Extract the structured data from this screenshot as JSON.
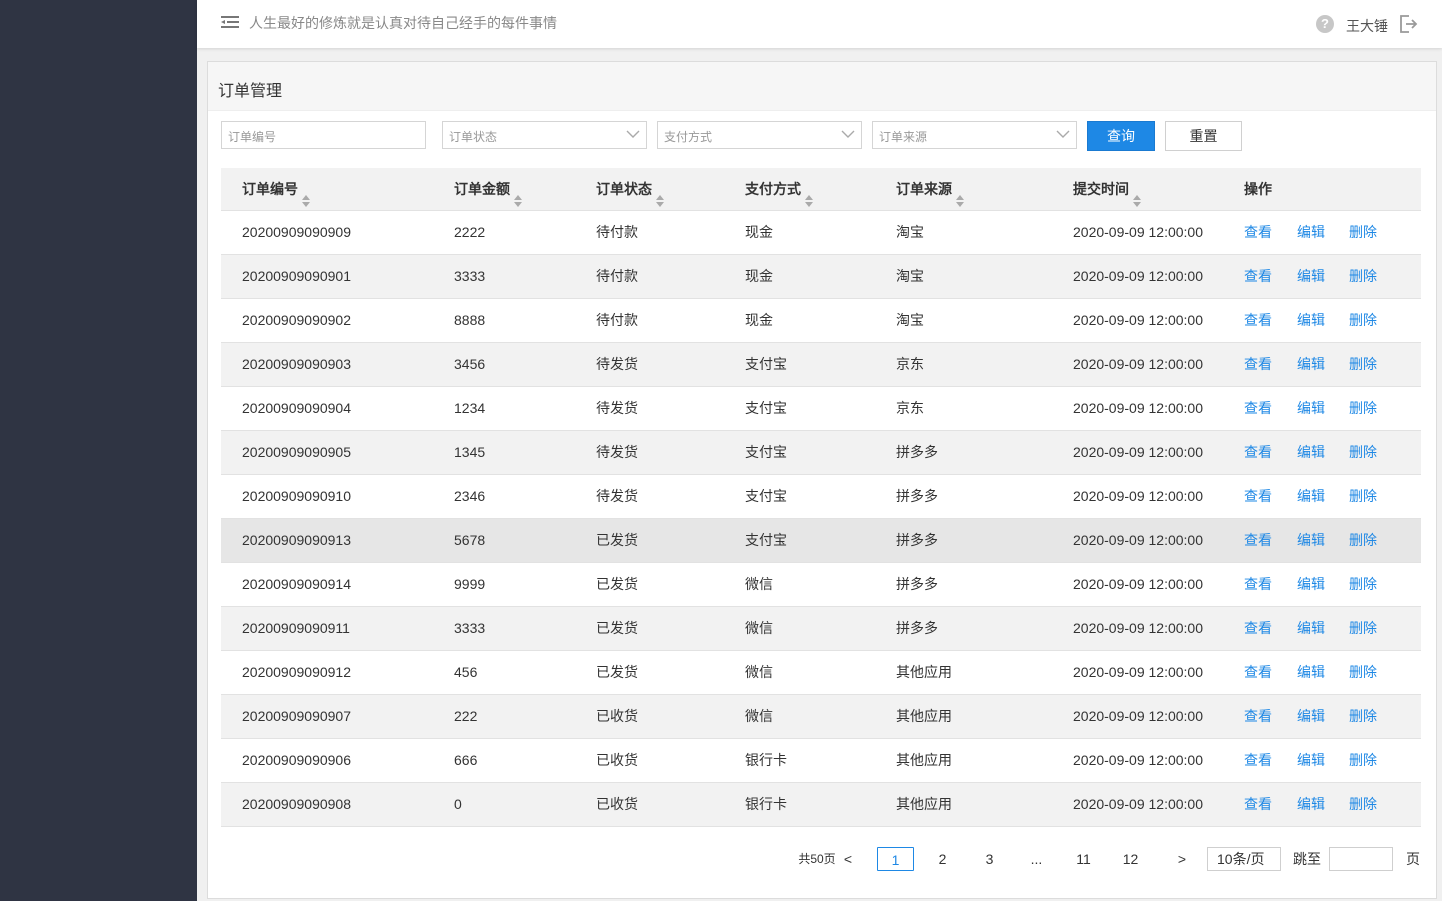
{
  "header": {
    "motto": "人生最好的修炼就是认真对待自己经手的每件事情",
    "username": "王大锤",
    "help_icon": "?"
  },
  "panel": {
    "title": "订单管理"
  },
  "filters": {
    "order_no_placeholder": "订单编号",
    "status_placeholder": "订单状态",
    "payment_placeholder": "支付方式",
    "source_placeholder": "订单来源",
    "query_label": "查询",
    "reset_label": "重置"
  },
  "table": {
    "columns": [
      "订单编号",
      "订单金额",
      "订单状态",
      "支付方式",
      "订单来源",
      "提交时间",
      "操作"
    ],
    "rows": [
      [
        "20200909090909",
        "2222",
        "待付款",
        "现金",
        "淘宝",
        "2020-09-09 12:00:00"
      ],
      [
        "20200909090901",
        "3333",
        "待付款",
        "现金",
        "淘宝",
        "2020-09-09 12:00:00"
      ],
      [
        "20200909090902",
        "8888",
        "待付款",
        "现金",
        "淘宝",
        "2020-09-09 12:00:00"
      ],
      [
        "20200909090903",
        "3456",
        "待发货",
        "支付宝",
        "京东",
        "2020-09-09 12:00:00"
      ],
      [
        "20200909090904",
        "1234",
        "待发货",
        "支付宝",
        "京东",
        "2020-09-09 12:00:00"
      ],
      [
        "20200909090905",
        "1345",
        "待发货",
        "支付宝",
        "拼多多",
        "2020-09-09 12:00:00"
      ],
      [
        "20200909090910",
        "2346",
        "待发货",
        "支付宝",
        "拼多多",
        "2020-09-09 12:00:00"
      ],
      [
        "20200909090913",
        "5678",
        "已发货",
        "支付宝",
        "拼多多",
        "2020-09-09 12:00:00"
      ],
      [
        "20200909090914",
        "9999",
        "已发货",
        "微信",
        "拼多多",
        "2020-09-09 12:00:00"
      ],
      [
        "20200909090911",
        "3333",
        "已发货",
        "微信",
        "拼多多",
        "2020-09-09 12:00:00"
      ],
      [
        "20200909090912",
        "456",
        "已发货",
        "微信",
        "其他应用",
        "2020-09-09 12:00:00"
      ],
      [
        "20200909090907",
        "222",
        "已收货",
        "微信",
        "其他应用",
        "2020-09-09 12:00:00"
      ],
      [
        "20200909090906",
        "666",
        "已收货",
        "银行卡",
        "其他应用",
        "2020-09-09 12:00:00"
      ],
      [
        "20200909090908",
        "0",
        "已收货",
        "银行卡",
        "其他应用",
        "2020-09-09 12:00:00"
      ]
    ],
    "actions": [
      "查看",
      "编辑",
      "删除"
    ]
  },
  "pagination": {
    "total": "共50页",
    "prev": "<",
    "next": ">",
    "pages": [
      "1",
      "2",
      "3",
      "...",
      "11",
      "12"
    ],
    "current": "1",
    "page_size": "10条/页",
    "jump_label": "跳至",
    "page_suffix": "页"
  },
  "colors": {
    "sidebar": "#2f3443",
    "primary": "#1e88e5",
    "link": "#1e88e5"
  }
}
